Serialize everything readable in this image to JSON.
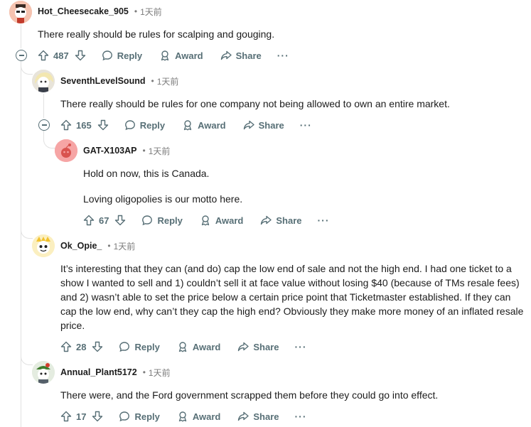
{
  "comments": [
    {
      "username": "Hot_Cheesecake_905",
      "separator": "•",
      "time": "1天前",
      "body": [
        "There really should be rules for scalping and gouging."
      ],
      "votes": "487",
      "reply_label": "Reply",
      "award_label": "Award",
      "share_label": "Share",
      "more_label": "···"
    },
    {
      "username": "SeventhLevelSound",
      "separator": "•",
      "time": "1天前",
      "body": [
        "There really should be rules for one company not being allowed to own an entire market."
      ],
      "votes": "165",
      "reply_label": "Reply",
      "award_label": "Award",
      "share_label": "Share",
      "more_label": "···"
    },
    {
      "username": "GAT-X103AP",
      "separator": "•",
      "time": "1天前",
      "body": [
        "Hold on now, this is Canada.",
        "Loving oligopolies is our motto here."
      ],
      "votes": "67",
      "reply_label": "Reply",
      "award_label": "Award",
      "share_label": "Share",
      "more_label": "···"
    },
    {
      "username": "Ok_Opie_",
      "separator": "•",
      "time": "1天前",
      "body": [
        "It’s interesting that they can (and do) cap the low end of sale and not the high end. I had one ticket to a show I wanted to sell and 1) couldn’t sell it at face value without losing $40 (because of TMs resale fees) and 2) wasn’t able to set the price below a certain price point that Ticketmaster established. If they can cap the low end, why can’t they cap the high end? Obviously they make more money of an inflated resale price."
      ],
      "votes": "28",
      "reply_label": "Reply",
      "award_label": "Award",
      "share_label": "Share",
      "more_label": "···"
    },
    {
      "username": "Annual_Plant5172",
      "separator": "•",
      "time": "1天前",
      "body": [
        "There were, and the Ford government scrapped them before they could go into effect."
      ],
      "votes": "17",
      "reply_label": "Reply",
      "award_label": "Award",
      "share_label": "Share",
      "more_label": "···"
    }
  ],
  "icons": {
    "upvote": "upvote-arrow-icon",
    "downvote": "downvote-arrow-icon",
    "reply": "speech-bubble-icon",
    "award": "award-ribbon-icon",
    "share": "share-arrow-icon",
    "collapse": "collapse-minus-icon"
  },
  "colors": {
    "text": "#1c1c1c",
    "meta": "#7c7c7c",
    "action": "#576f76",
    "thread_line": "#e1e1e1"
  }
}
